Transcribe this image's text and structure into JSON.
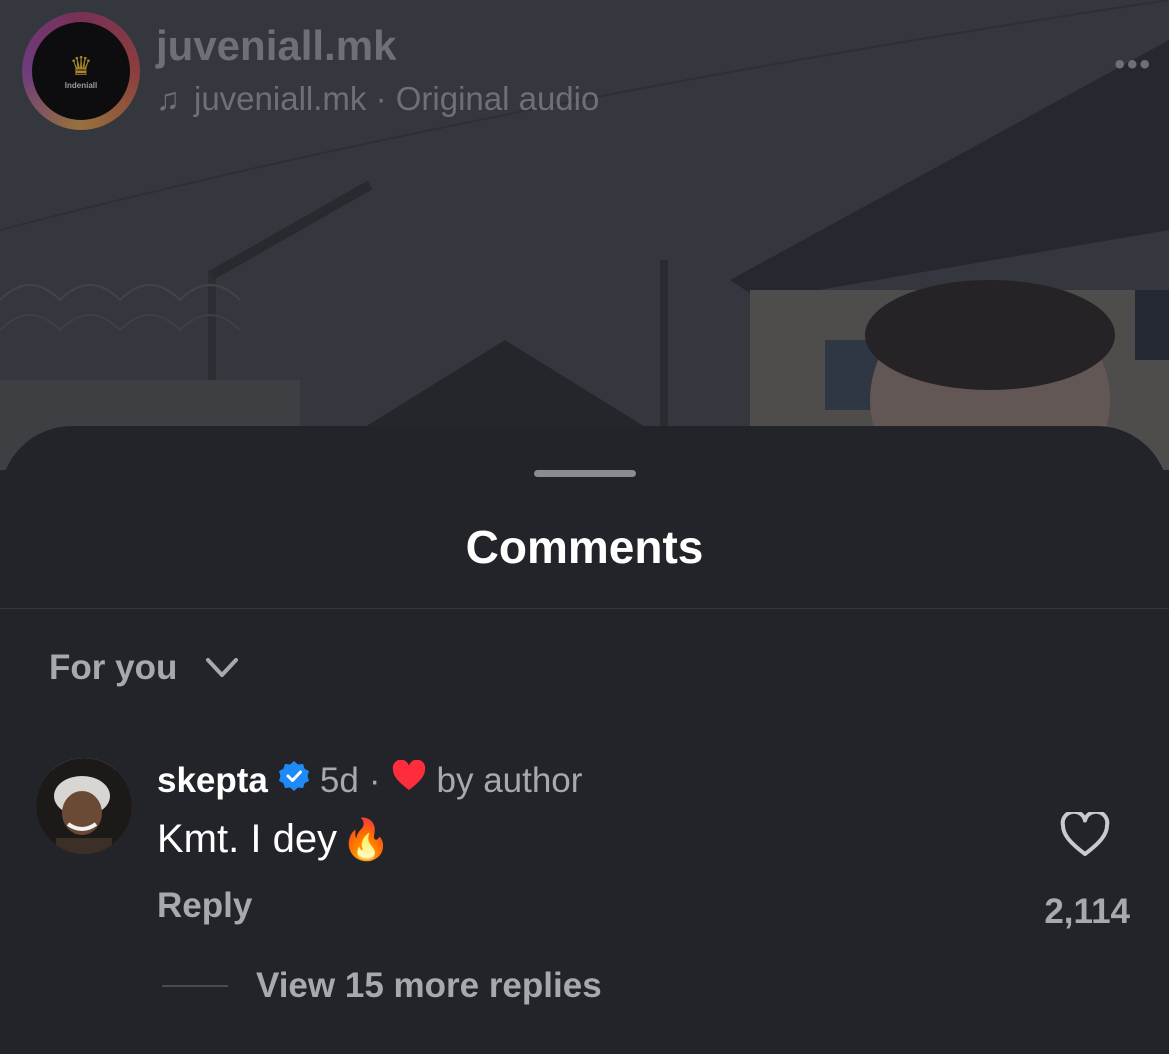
{
  "reel": {
    "username": "juveniall.mk",
    "audio": "juveniall.mk · Original audio",
    "avatar_text": "Indeniall",
    "icons": {
      "audio": "music-note-icon",
      "more": "more-options-icon"
    }
  },
  "comments_sheet": {
    "title": "Comments",
    "sort_label": "For you",
    "comments": [
      {
        "username": "skepta",
        "verified": true,
        "age": "5d",
        "separator": "·",
        "liked_by_author_label": "by author",
        "text": "Kmt. I dey",
        "emoji": "🔥",
        "reply_label": "Reply",
        "like_count": "2,114",
        "view_replies_label": "View 15 more replies"
      }
    ]
  },
  "colors": {
    "sheet_bg": "#23242a",
    "verified_blue": "#1e8af7",
    "heart_red": "#ff2d3c",
    "secondary_text": "#a7a9ae"
  }
}
